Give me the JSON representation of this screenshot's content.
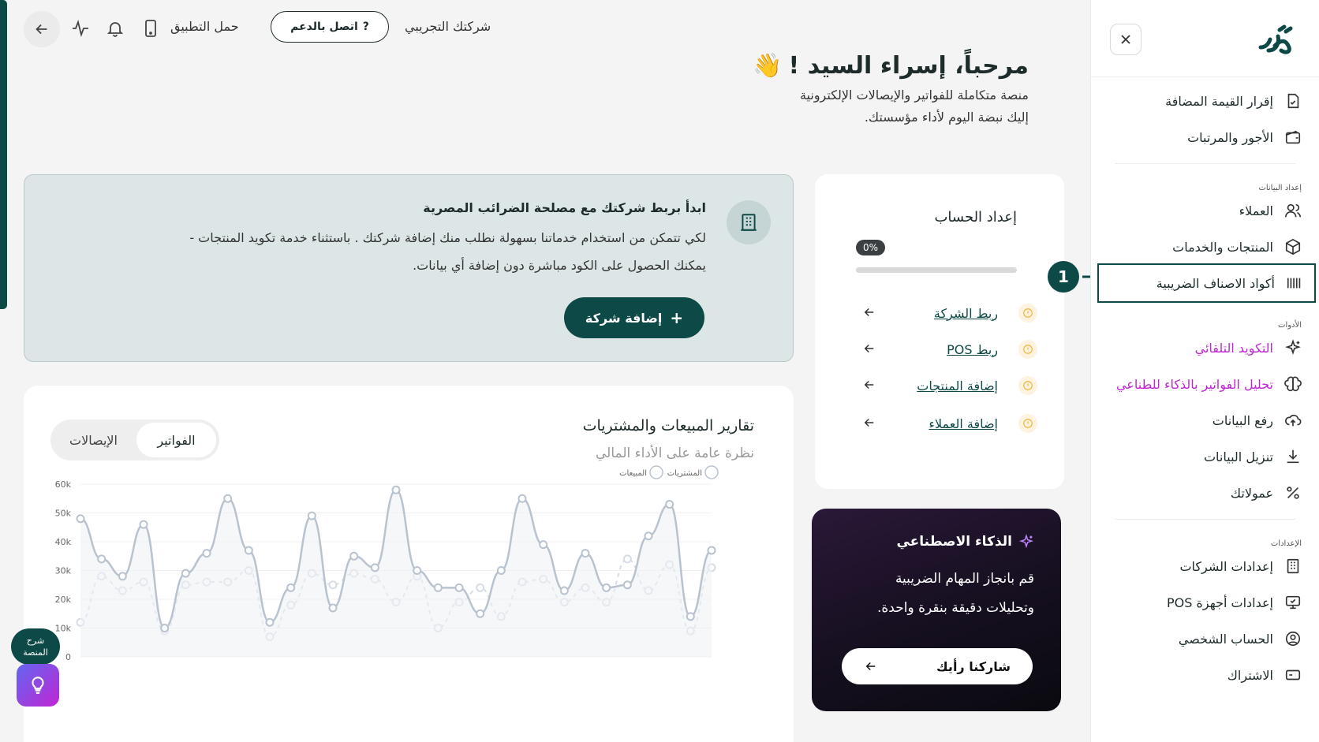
{
  "sidebar": {
    "items_top": [
      {
        "label": "إقرار القيمة المضافة",
        "icon": "file-check-icon"
      },
      {
        "label": "الأجور والمرتبات",
        "icon": "wallet-icon"
      }
    ],
    "sections": {
      "data_setup": "إعداد البيانات",
      "tools": "الأدوات",
      "settings": "الإعدادات"
    },
    "data_items": [
      {
        "label": "العملاء",
        "icon": "users-icon"
      },
      {
        "label": "المنتجات والخدمات",
        "icon": "box-icon"
      },
      {
        "label": "أكواد الاصناف الضريبية",
        "icon": "barcode-icon"
      }
    ],
    "tool_items": [
      {
        "label": "التكويد التلقائي",
        "icon": "sparkle-icon"
      },
      {
        "label": "تحليل الفواتير بالذكاء للطناعي",
        "icon": "brain-icon"
      },
      {
        "label": "رفع البيانات",
        "icon": "cloud-upload-icon"
      },
      {
        "label": "تنزيل البيانات",
        "icon": "download-icon"
      },
      {
        "label": "عمولاتك",
        "icon": "percent-icon"
      }
    ],
    "setting_items": [
      {
        "label": "إعدادات الشركات",
        "icon": "building-icon"
      },
      {
        "label": "إعدادات أجهزة POS",
        "icon": "monitor-icon"
      },
      {
        "label": "الحساب الشخصي",
        "icon": "user-circle-icon"
      },
      {
        "label": "الاشتراك",
        "icon": "card-icon"
      }
    ],
    "callout_number": "1"
  },
  "topbar": {
    "company": "شركتك التجريبي",
    "support_label": "اتصل بالدعم",
    "download_app": "حمل التطبيق"
  },
  "welcome": {
    "title": "مرحباً، إسراء السيد !",
    "emoji": "👋",
    "line1": "منصة متكاملة للفواتير والإيصالات الإلكترونية",
    "line2": "إليك نبضة اليوم لأداء مؤسستك."
  },
  "banner": {
    "title": "ابدأ بربط شركتك مع مصلحة الضرائب المصرية",
    "desc_line1": "لكي تتمكن من استخدام خدماتنا بسهولة نطلب منك إضافة شركتك . باستثناء خدمة تكويد المنتجات -",
    "desc_line2": "يمكنك الحصول على الكود مباشرة دون إضافة أي بيانات.",
    "button": "إضافة شركة"
  },
  "setup": {
    "title": "إعداد الحساب",
    "progress_text": "0%",
    "progress": 0,
    "steps": [
      "ربط الشركة",
      "ربط POS",
      "إضافة المنتجات",
      "إضافة العملاء"
    ]
  },
  "ai": {
    "title": "الذكاء الاصطناعي",
    "line1": "قم بانجاز المهام الضريبية",
    "line2": "وتحليلات دقيقة بنقرة واحدة.",
    "button": "شاركنا رأيك"
  },
  "report": {
    "title": "تقارير المبيعات والمشتريات",
    "subtitle": "نظرة عامة على الأداء المالي",
    "tabs": [
      "الفواتير",
      "الإيصالات"
    ],
    "active_tab": 0
  },
  "help": {
    "label_line1": "شرح",
    "label_line2": "المنصة"
  },
  "chart_data": {
    "type": "line",
    "legend": [
      "المبيعات",
      "المشتريات"
    ],
    "legend_position": "top-right",
    "ylim": [
      0,
      60000
    ],
    "y_ticks": [
      "0",
      "10k",
      "20k",
      "30k",
      "40k",
      "50k",
      "60k"
    ],
    "grid": true,
    "series": [
      {
        "name": "المبيعات",
        "color": "#b9c3cf",
        "values": [
          48000,
          34000,
          28000,
          46000,
          10000,
          29000,
          36000,
          55000,
          37000,
          12000,
          24000,
          49000,
          17000,
          35000,
          31000,
          58000,
          30000,
          24000,
          24000,
          15000,
          30000,
          55000,
          39000,
          23000,
          36000,
          24000,
          25000,
          42000,
          53000,
          14000,
          37000
        ]
      },
      {
        "name": "المشتريات",
        "color": "#d6dde6",
        "values": [
          12000,
          28000,
          23000,
          26000,
          9000,
          25000,
          26000,
          26000,
          30000,
          7000,
          18000,
          29000,
          25000,
          29000,
          27000,
          19000,
          28000,
          10000,
          19000,
          24000,
          14000,
          26000,
          27000,
          19000,
          24000,
          19000,
          34000,
          23000,
          32000,
          9000,
          31000
        ]
      }
    ]
  }
}
